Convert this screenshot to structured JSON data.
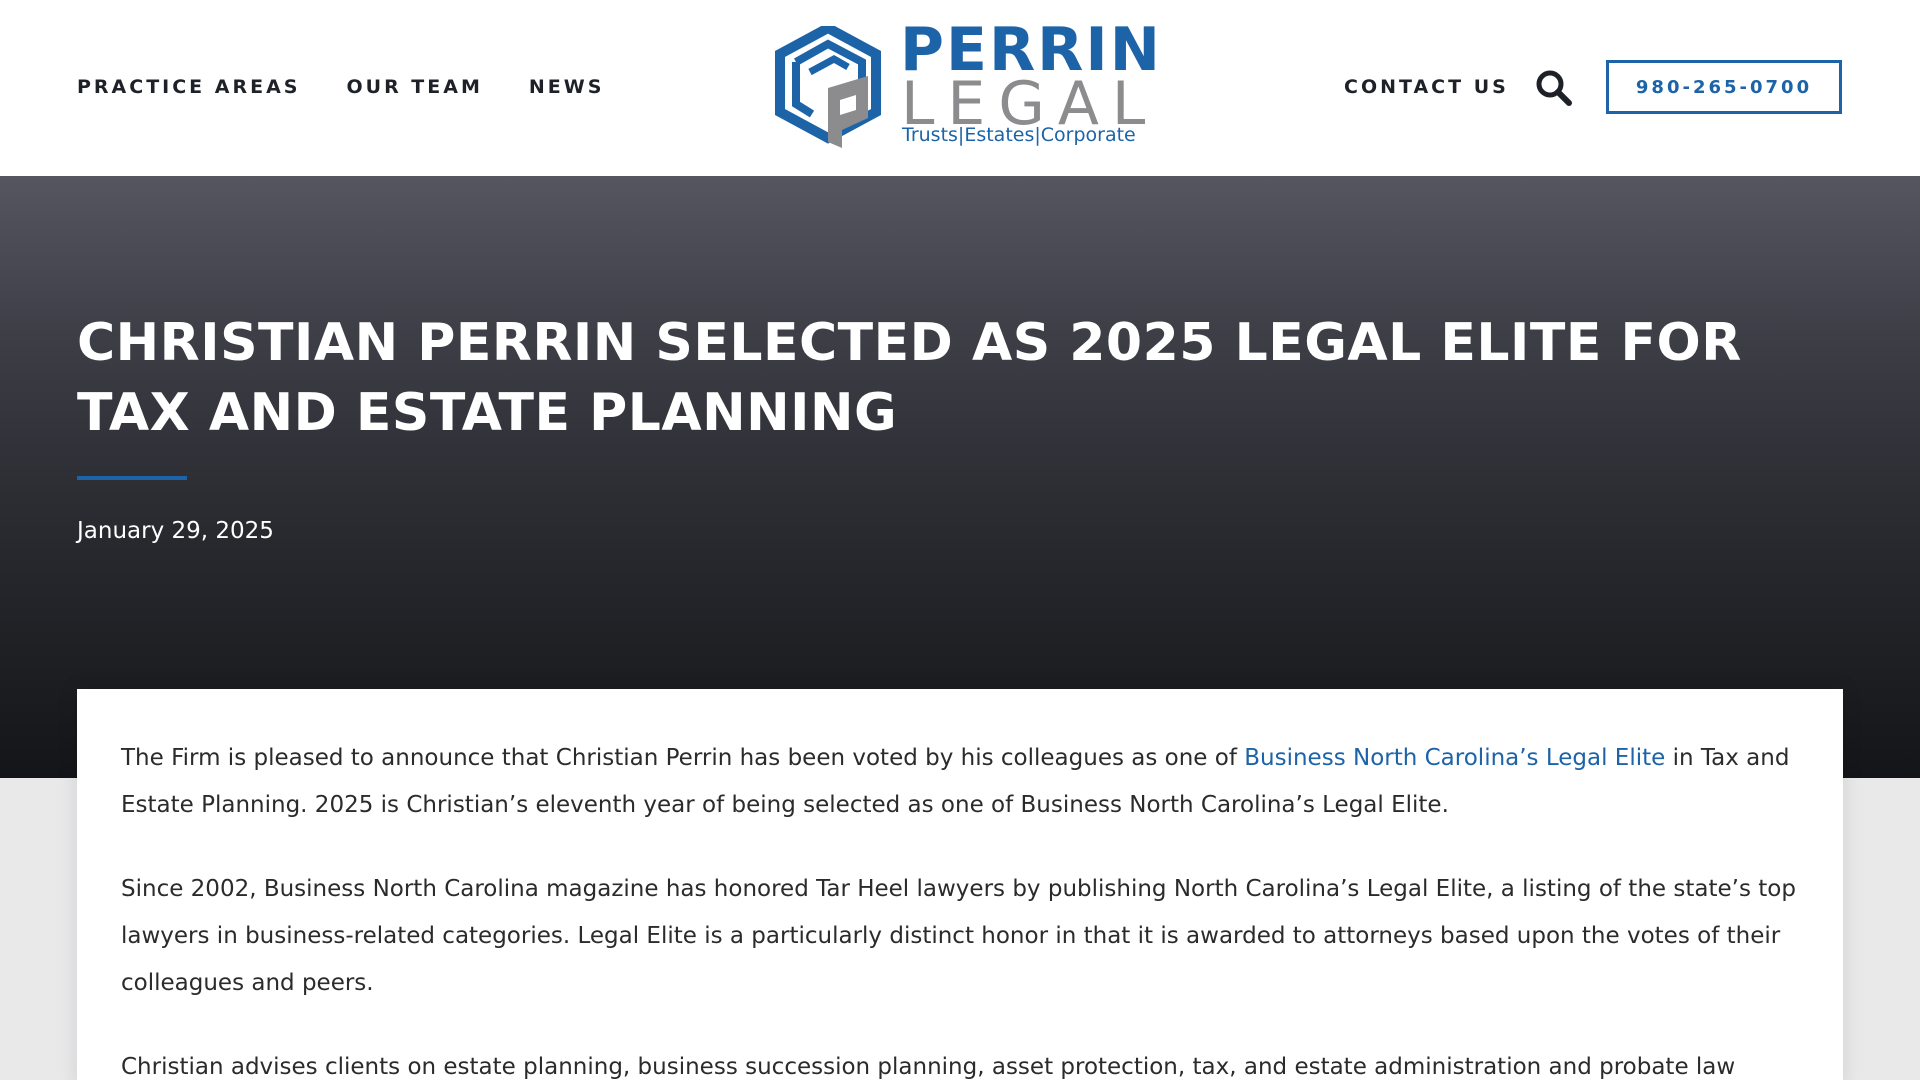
{
  "header": {
    "nav": [
      {
        "label": "PRACTICE AREAS"
      },
      {
        "label": "OUR TEAM"
      },
      {
        "label": "NEWS"
      }
    ],
    "logo": {
      "name": "PERRIN",
      "sub": "LEGAL",
      "tagline": "Trusts|Estates|Corporate"
    },
    "contact_label": "CONTACT US",
    "search_icon": "search-icon",
    "phone": "980-265-0700"
  },
  "colors": {
    "brand_blue": "#1c63a8",
    "logo_gray": "#8c8c8f",
    "hero_top": "#555660",
    "hero_bottom": "#141518"
  },
  "hero": {
    "title": "CHRISTIAN PERRIN SELECTED AS 2025 LEGAL ELITE FOR TAX AND ESTATE PLANNING",
    "date": "January 29, 2025"
  },
  "article": {
    "p1_before": "The Firm is pleased to announce that Christian Perrin has been voted by his colleagues as one of ",
    "p1_link": "Business North Carolina’s Legal Elite",
    "p1_after": " in Tax and Estate Planning.  2025 is Christian’s eleventh year of being selected as one of Business North Carolina’s Legal Elite.",
    "p2": "Since 2002, Business North Carolina magazine has honored Tar Heel lawyers by publishing North Carolina’s Legal Elite, a listing of the state’s top lawyers in business-related categories.  Legal Elite is a particularly distinct honor in that it is awarded to attorneys based upon the votes of their colleagues and peers.",
    "p3": "Christian advises clients on estate planning, business succession planning, asset protection, tax, and estate administration and probate law"
  }
}
